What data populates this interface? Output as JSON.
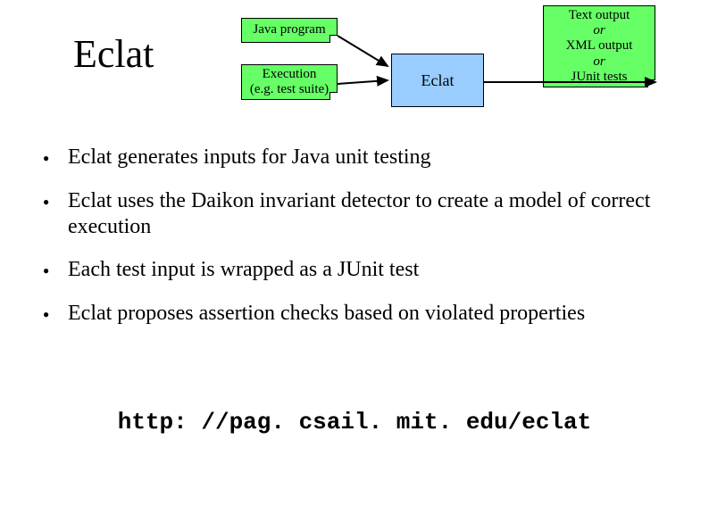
{
  "title": "Eclat",
  "diagram": {
    "java_box": "Java program",
    "exec_box_line1": "Execution",
    "exec_box_line2": "(e.g. test suite)",
    "eclat_box": "Eclat",
    "output_line1": "Text output",
    "output_or1": "or",
    "output_line2": "XML output",
    "output_or2": "or",
    "output_line3": "JUnit tests"
  },
  "bullets": [
    "Eclat generates inputs for Java unit testing",
    "Eclat uses the Daikon invariant detector to create a model of correct execution",
    "Each test input is wrapped as a JUnit test",
    "Eclat proposes assertion checks based on violated properties"
  ],
  "url": "http: //pag. csail. mit. edu/eclat"
}
